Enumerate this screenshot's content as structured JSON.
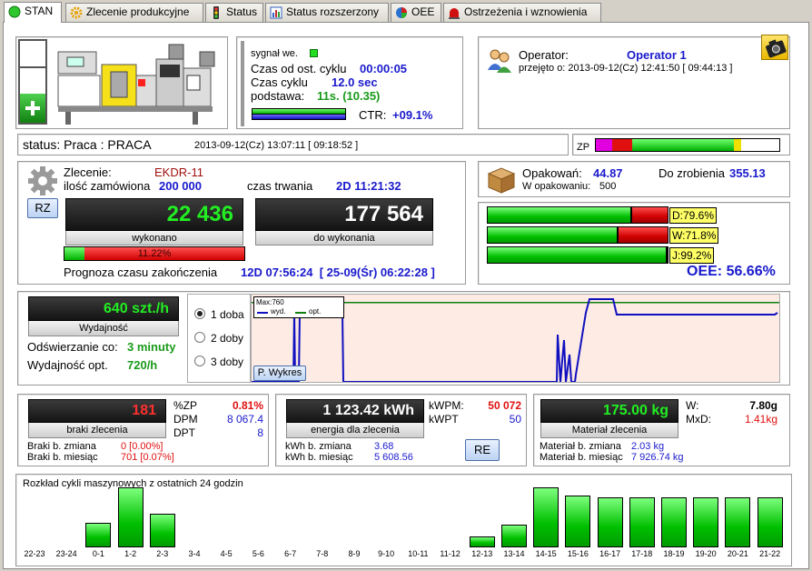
{
  "tabs": [
    {
      "label": "STAN",
      "icon": "green-circle-icon",
      "color": "#1db31d"
    },
    {
      "label": "Zlecenie produkcyjne",
      "icon": "gear-icon",
      "color": "#e8a000"
    },
    {
      "label": "Status",
      "icon": "traffic-light-icon",
      "color": "#333333"
    },
    {
      "label": "Status rozszerzony",
      "icon": "chart-icon",
      "color": "#3060c0"
    },
    {
      "label": "OEE",
      "icon": "pie-chart-icon",
      "color": "#d02020"
    },
    {
      "label": "Ostrzeżenia i wznowienia",
      "icon": "alarm-icon",
      "color": "#c01010"
    }
  ],
  "signal": {
    "label": "sygnał we.",
    "cycle_since_label": "Czas od ost. cyklu",
    "cycle_since": "00:00:05",
    "cycle_label": "Czas cyklu",
    "cycle": "12.0 sec",
    "base_label": "podstawa:",
    "base": "11s. (10.35)",
    "ctr_label": "CTR:",
    "ctr": "+09.1%"
  },
  "operator": {
    "label": "Operator:",
    "name": "Operator 1",
    "taken": "przejęto o: 2013-09-12(Cz) 12:41:50  [ 09:44:13 ]"
  },
  "status": {
    "text": "status: Praca : PRACA",
    "time": "2013-09-12(Cz) 13:07:11  [ 09:18:52 ]",
    "zp_label": "ZP"
  },
  "order": {
    "label": "Zlecenie:",
    "value": "EKDR-11",
    "qty_label": "ilość zamówiona",
    "qty": "200 000",
    "duration_label": "czas trwania",
    "duration": "2D 11:21:32",
    "rz": "RZ",
    "done": "22 436",
    "done_label": "wykonano",
    "todo": "177 564",
    "todo_label": "do wykonania",
    "progress": "11.22%",
    "progress_value": 11.22,
    "forecast_label": "Prognoza czasu zakończenia",
    "forecast": "12D 07:56:24  [ 25-09(Śr) 06:22:28 ]"
  },
  "package": {
    "label": "Opakowań:",
    "value": "44.87",
    "todo_label": "Do zrobienia",
    "todo": "355.13",
    "inpack_label": "W opakowaniu:",
    "inpack": "500"
  },
  "oee": {
    "d_label": "D:79.6%",
    "d": 79.6,
    "w_label": "W:71.8%",
    "w": 71.8,
    "j_label": "J:99.2%",
    "j": 99.2,
    "total": "OEE: 56.66%"
  },
  "perf": {
    "value": "640 szt./h",
    "label": "Wydajność",
    "refresh_label": "Odświerzanie co:",
    "refresh": "3 minuty",
    "opt_label": "Wydajność opt.",
    "opt": "720/h",
    "options": [
      "1 doba",
      "2 doby",
      "3 doby"
    ],
    "selected": 0,
    "chart_btn": "P. Wykres",
    "max_label": "Max:760",
    "legend_wyd": "wyd.",
    "legend_opt": "opt."
  },
  "scrap": {
    "value": "181",
    "label": "braki zlecenia",
    "zp_label": "%ZP",
    "zp": "0.81%",
    "dpm_label": "DPM",
    "dpm": "8 067.4",
    "dpt_label": "DPT",
    "dpt": "8",
    "shift_label": "Braki b. zmiana",
    "shift": "0 [0.00%]",
    "month_label": "Braki b. miesiąc",
    "month": "701 [0.07%]"
  },
  "energy": {
    "value": "1 123.42 kWh",
    "label": "energia dla zlecenia",
    "kwpm_label": "kWPM:",
    "kwpm": "50 072",
    "kwpt_label": "kWPT",
    "kwpt": "50",
    "shift_label": "kWh b. zmiana",
    "shift": "3.68",
    "month_label": "kWh b. miesiąc",
    "month": "5 608.56",
    "re": "RE"
  },
  "material": {
    "value": "175.00 kg",
    "label": "Materiał zlecenia",
    "w_label": "W:",
    "w": "7.80g",
    "mxd_label": "MxD:",
    "mxd": "1.41kg",
    "shift_label": "Materiał b. zmiana",
    "shift": "2.03 kg",
    "month_label": "Materiał b. miesiąc",
    "month": "7 926.74 kg"
  },
  "chart_data": {
    "type": "bar",
    "title": "Rozkład cykli maszynowych z ostatnich 24 godzin",
    "categories": [
      "22-23",
      "23-24",
      "0-1",
      "1-2",
      "2-3",
      "3-4",
      "4-5",
      "5-6",
      "6-7",
      "7-8",
      "8-9",
      "9-10",
      "10-11",
      "11-12",
      "12-13",
      "13-14",
      "14-15",
      "15-16",
      "16-17",
      "17-18",
      "18-19",
      "19-20",
      "20-21",
      "21-22"
    ],
    "values": [
      0,
      0,
      48,
      118,
      66,
      0,
      0,
      0,
      0,
      0,
      0,
      0,
      0,
      0,
      22,
      44,
      118,
      103,
      98,
      98,
      98,
      98,
      98,
      98
    ],
    "ylim": [
      0,
      125
    ]
  },
  "perf_chart": {
    "type": "line",
    "series": [
      {
        "name": "wyd.",
        "color": "#1010c0"
      },
      {
        "name": "opt.",
        "color": "#108010",
        "value": 720
      }
    ],
    "ylim": [
      0,
      760
    ]
  }
}
